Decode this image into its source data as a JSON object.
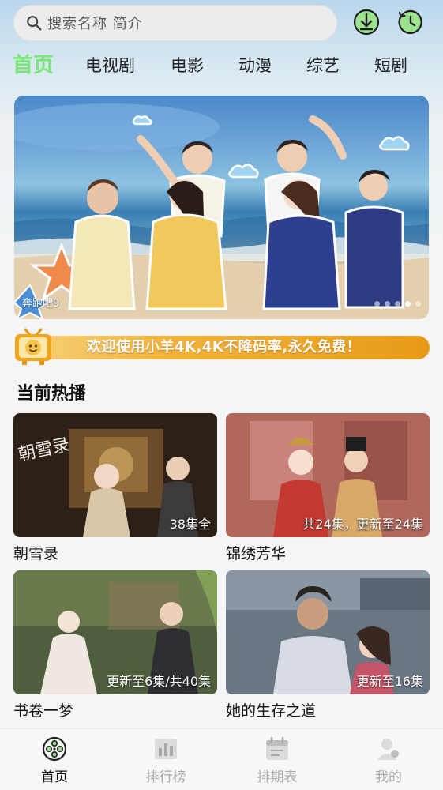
{
  "search": {
    "placeholder": "搜索名称 简介"
  },
  "header_icons": [
    "download-icon",
    "history-icon"
  ],
  "tabs": [
    {
      "label": "首页",
      "active": true
    },
    {
      "label": "电视剧"
    },
    {
      "label": "电影"
    },
    {
      "label": "动漫"
    },
    {
      "label": "综艺"
    },
    {
      "label": "短剧"
    }
  ],
  "banner": {
    "caption": "奔跑吧9",
    "slide_count": 5,
    "active_slide": 4
  },
  "notice": {
    "text": "欢迎使用小羊4K,4K不降码率,永久免费！"
  },
  "section": {
    "title": "当前热播"
  },
  "cards": [
    {
      "title": "朝雪录",
      "badge": "38集全"
    },
    {
      "title": "锦绣芳华",
      "badge": "共24集，更新至24集"
    },
    {
      "title": "书卷一梦",
      "badge": "更新至6集/共40集"
    },
    {
      "title": "她的生存之道",
      "badge": "更新至16集"
    }
  ],
  "bottom_nav": [
    {
      "label": "首页",
      "icon": "film-reel-icon",
      "active": true
    },
    {
      "label": "排行榜",
      "icon": "bar-chart-icon"
    },
    {
      "label": "排期表",
      "icon": "calendar-icon"
    },
    {
      "label": "我的",
      "icon": "user-icon"
    }
  ],
  "colors": {
    "accent": "#7de37f",
    "notice_orange": "#e79a17"
  }
}
